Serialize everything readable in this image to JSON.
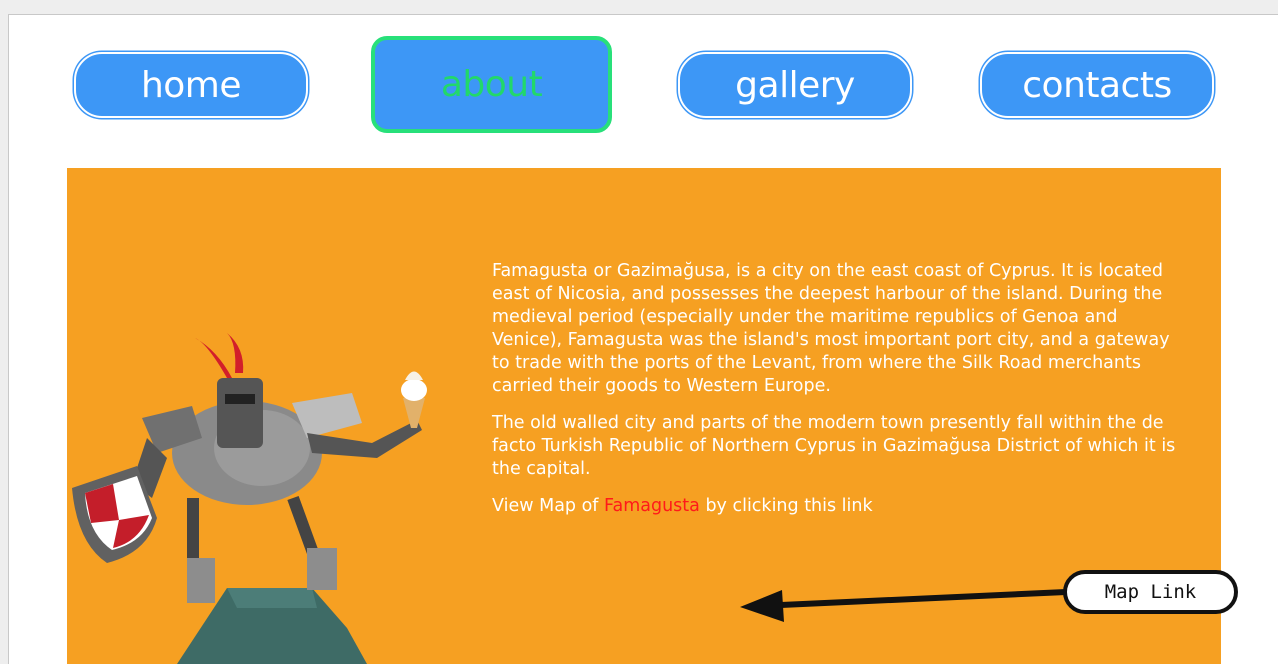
{
  "nav": {
    "home": "home",
    "about": "about",
    "gallery": "gallery",
    "contacts": "contacts",
    "active": "about"
  },
  "content": {
    "paragraph1": "Famagusta or Gazimağusa, is a city on the east coast of Cyprus. It is located east of Nicosia, and possesses the deepest harbour of the island. During the medieval period (especially under the maritime republics of Genoa and Venice), Famagusta was the island's most important port city, and a gateway to trade with the ports of the Levant, from where the Silk Road merchants carried their goods to Western Europe.",
    "paragraph2": "The old walled city and parts of the modern town presently fall within the de facto Turkish Republic of Northern Cyprus in Gazimağusa District of which it is the capital.",
    "map_prefix": "View Map of ",
    "map_link": "Famagusta",
    "map_suffix": " by clicking this link"
  },
  "annotation": {
    "label": "Map Link"
  },
  "colors": {
    "nav_blue": "#3d97f6",
    "active_green": "#28e07a",
    "hero_orange": "#f6a022",
    "link_red": "#ff1a1a"
  },
  "icons": {
    "hero_illustration": "knight-with-ice-cream",
    "annotation_arrow": "arrow-left"
  }
}
